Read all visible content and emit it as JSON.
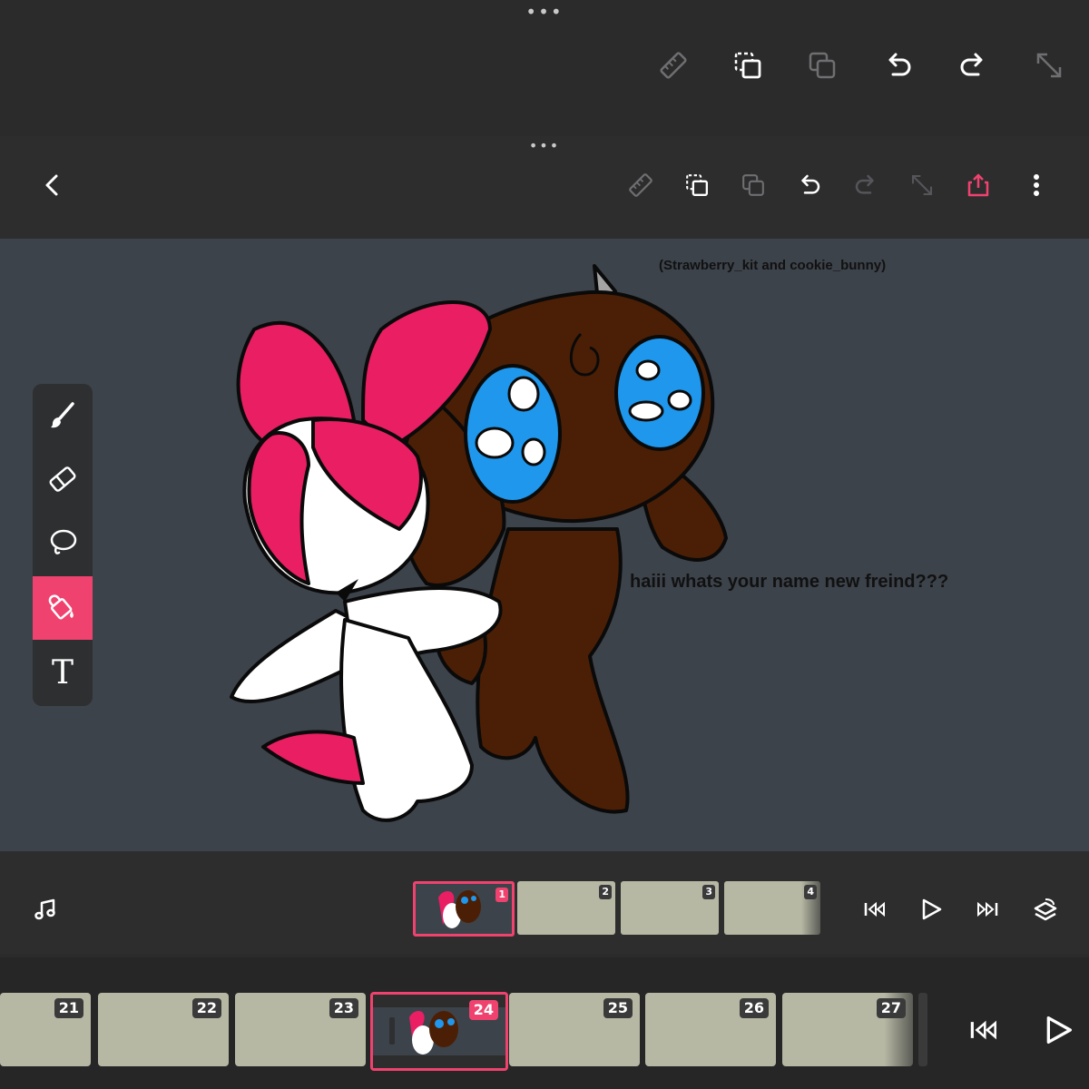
{
  "outer_toolbar": {
    "handle": "•••",
    "icons": [
      "ruler-icon",
      "duplicate-frame-icon",
      "copy-icon",
      "undo-icon",
      "redo-icon",
      "expand-icon"
    ]
  },
  "inner_toolbar": {
    "handle": "•••",
    "back": "back-icon",
    "icons": [
      "ruler-icon",
      "duplicate-frame-icon",
      "copy-icon",
      "undo-icon",
      "redo-icon",
      "expand-icon",
      "share-icon",
      "more-icon"
    ],
    "accent": "#f0426e"
  },
  "canvas": {
    "caption_top": "(Strawberry_kit and cookie_bunny)",
    "caption_speech": "haiii whats your name new freind???",
    "background": "#3d434b"
  },
  "tools": [
    {
      "name": "brush",
      "icon": "brush-icon"
    },
    {
      "name": "eraser",
      "icon": "eraser-icon"
    },
    {
      "name": "lasso",
      "icon": "lasso-icon"
    },
    {
      "name": "fill",
      "icon": "fill-bucket-icon",
      "active": true
    },
    {
      "name": "text",
      "icon": "text-icon",
      "glyph": "T"
    }
  ],
  "timeline_inner": {
    "frames": [
      "1",
      "2",
      "3",
      "4"
    ],
    "selected": "1"
  },
  "timeline_outer": {
    "frames": [
      "21",
      "22",
      "23",
      "24",
      "25",
      "26",
      "27"
    ],
    "selected": "24"
  }
}
